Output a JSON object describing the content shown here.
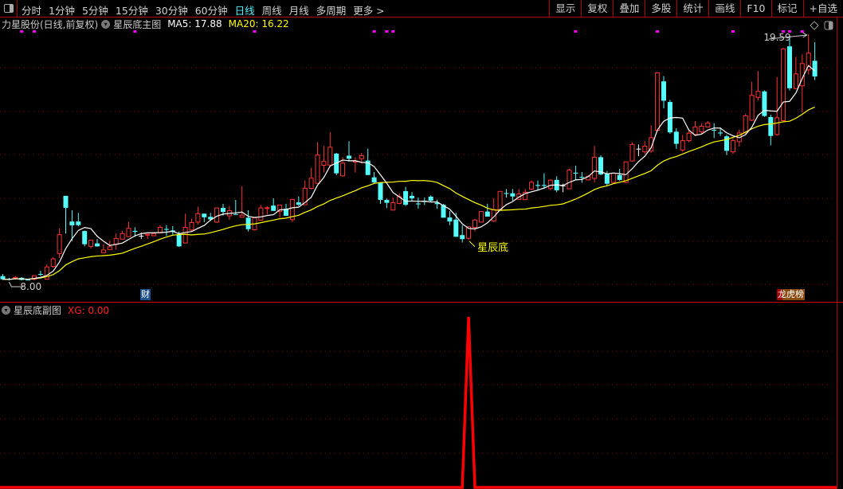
{
  "toolbar": {
    "periods": [
      "分时",
      "1分钟",
      "5分钟",
      "15分钟",
      "30分钟",
      "60分钟",
      "日线",
      "周线",
      "月线",
      "多周期",
      "更多 >"
    ],
    "active_period": "日线",
    "right_buttons": [
      "显示",
      "复权",
      "叠加",
      "多股",
      "统计",
      "画线",
      "F10",
      "标记",
      "+自选"
    ]
  },
  "header": {
    "stock": "力星股份(日线,前复权)",
    "indicator": "星辰底主图",
    "ma5": "MA5: 17.88",
    "ma20": "MA20: 16.22"
  },
  "sub_header": {
    "indicator": "星辰底副图",
    "xg": "XG: 0.00"
  },
  "annotations": {
    "low_label": "8.00",
    "high_label": "19.59",
    "signal_label": "星辰底",
    "badge_cai": "财",
    "badge_lhb": "龙虎榜"
  },
  "colors": {
    "up": "#ff3232",
    "down": "#54fcfc",
    "doji": "#ffffff",
    "ma5": "#ffffff",
    "ma20": "#ffff00",
    "xg": "#ff0000",
    "grid": "#800000",
    "marker": "#ff00ff"
  },
  "chart_data": [
    {
      "type": "candlestick",
      "title": "星辰底主图",
      "series": [
        {
          "name": "MA5",
          "period": 5
        },
        {
          "name": "MA20",
          "period": 20
        }
      ],
      "price_range": [
        8.0,
        19.59
      ],
      "marker_candles": [
        3,
        5,
        21,
        40,
        59,
        61,
        62,
        91,
        104,
        116,
        124,
        125,
        127
      ],
      "signal_candle": 74,
      "badge_cai_candle": 22,
      "badge_lhb_candle": 123,
      "candles_ochl": [
        [
          8.2,
          8.05,
          8.3,
          8.02
        ],
        [
          8.06,
          8.04,
          8.12,
          8.0
        ],
        [
          8.1,
          8.14,
          8.2,
          8.04
        ],
        [
          8.12,
          8.02,
          8.15,
          8.0
        ],
        [
          8.03,
          8.02,
          8.05,
          8.0
        ],
        [
          8.05,
          8.22,
          8.22,
          8.0
        ],
        [
          8.3,
          8.28,
          8.45,
          8.2
        ],
        [
          8.06,
          8.63,
          8.75,
          8.06
        ],
        [
          8.65,
          9.01,
          9.1,
          8.6
        ],
        [
          9.26,
          10.15,
          10.45,
          9.05
        ],
        [
          11.98,
          11.41,
          11.98,
          10.2
        ],
        [
          10.77,
          10.59,
          11.3,
          9.86
        ],
        [
          10.77,
          10.6,
          11.18,
          10.55
        ],
        [
          10.32,
          9.7,
          10.35,
          9.6
        ],
        [
          9.6,
          9.89,
          9.89,
          9.5
        ],
        [
          9.74,
          9.6,
          9.95,
          9.58
        ],
        [
          9.3,
          9.43,
          9.7,
          9.3
        ],
        [
          9.45,
          9.58,
          9.86,
          9.45
        ],
        [
          9.7,
          9.97,
          10.2,
          9.45
        ],
        [
          9.94,
          10.2,
          10.33,
          9.94
        ],
        [
          10.06,
          10.45,
          10.75,
          10.06
        ],
        [
          10.33,
          10.28,
          10.5,
          10.05
        ],
        [
          10.1,
          10.1,
          10.25,
          9.95
        ],
        [
          10.13,
          10.17,
          10.2,
          9.95
        ],
        [
          10.1,
          10.2,
          10.2,
          10.1
        ],
        [
          10.24,
          10.5,
          10.6,
          10.24
        ],
        [
          10.42,
          10.38,
          10.6,
          10.1
        ],
        [
          10.35,
          10.3,
          10.55,
          10.15
        ],
        [
          10.18,
          9.6,
          10.3,
          9.58
        ],
        [
          9.76,
          10.49,
          11.14,
          9.76
        ],
        [
          10.37,
          10.72,
          10.9,
          10.3
        ],
        [
          10.74,
          11.14,
          11.47,
          10.62
        ],
        [
          11.14,
          10.97,
          11.14,
          10.74
        ],
        [
          10.99,
          10.87,
          11.18,
          10.8
        ],
        [
          10.74,
          11.41,
          11.41,
          10.7
        ],
        [
          11.41,
          11.22,
          11.6,
          11.05
        ],
        [
          11.04,
          11.28,
          11.5,
          10.85
        ],
        [
          11.12,
          11.1,
          11.79,
          11.1
        ],
        [
          10.97,
          11.07,
          12.43,
          10.97
        ],
        [
          10.95,
          10.41,
          11.3,
          10.3
        ],
        [
          10.38,
          10.95,
          10.95,
          10.35
        ],
        [
          10.83,
          11.41,
          11.55,
          10.83
        ],
        [
          11.38,
          11.42,
          11.5,
          11.1
        ],
        [
          11.52,
          11.27,
          11.86,
          11.27
        ],
        [
          11.24,
          11.55,
          11.55,
          10.95
        ],
        [
          11.37,
          11.04,
          11.6,
          11.04
        ],
        [
          10.86,
          11.81,
          11.81,
          10.75
        ],
        [
          11.67,
          11.56,
          11.95,
          11.5
        ],
        [
          11.56,
          12.34,
          12.7,
          11.56
        ],
        [
          12.33,
          12.81,
          13.3,
          12.28
        ],
        [
          12.57,
          13.9,
          14.5,
          12.57
        ],
        [
          13.42,
          13.6,
          14.33,
          13.08
        ],
        [
          13.43,
          14.27,
          14.97,
          13.4
        ],
        [
          13.97,
          13.04,
          14.0,
          12.95
        ],
        [
          12.92,
          13.52,
          13.8,
          12.88
        ],
        [
          13.87,
          13.73,
          14.55,
          13.6
        ],
        [
          13.57,
          13.62,
          13.8,
          13.08
        ],
        [
          13.73,
          13.87,
          14.0,
          13.5
        ],
        [
          13.64,
          12.96,
          14.2,
          12.96
        ],
        [
          12.85,
          12.61,
          13.1,
          12.55
        ],
        [
          12.6,
          11.79,
          12.6,
          11.6
        ],
        [
          11.79,
          11.65,
          11.85,
          11.4
        ],
        [
          11.31,
          11.66,
          11.9,
          11.31
        ],
        [
          11.62,
          11.94,
          12.1,
          11.58
        ],
        [
          12.2,
          11.56,
          12.4,
          11.5
        ],
        [
          11.98,
          11.86,
          12.15,
          11.75
        ],
        [
          11.62,
          11.58,
          11.9,
          11.38
        ],
        [
          11.75,
          11.7,
          11.9,
          11.55
        ],
        [
          11.94,
          11.75,
          12.0,
          11.7
        ],
        [
          11.66,
          11.59,
          11.8,
          11.37
        ],
        [
          11.56,
          10.95,
          11.6,
          10.95
        ],
        [
          10.96,
          10.77,
          11.26,
          10.6
        ],
        [
          10.86,
          10.05,
          11.18,
          10.05
        ],
        [
          10.13,
          9.94,
          10.6,
          9.78
        ],
        [
          9.98,
          10.52,
          10.55,
          9.92
        ],
        [
          10.49,
          10.84,
          10.9,
          10.3
        ],
        [
          10.74,
          11.24,
          11.26,
          10.72
        ],
        [
          11.24,
          11.0,
          11.61,
          11.0
        ],
        [
          10.8,
          11.33,
          11.86,
          10.75
        ],
        [
          11.34,
          12.19,
          12.19,
          11.3
        ],
        [
          12.11,
          12.07,
          12.3,
          11.9
        ],
        [
          12.1,
          11.95,
          12.3,
          11.75
        ],
        [
          11.81,
          12.07,
          12.3,
          11.8
        ],
        [
          11.8,
          12.15,
          12.3,
          11.8
        ],
        [
          12.29,
          12.62,
          12.7,
          12.25
        ],
        [
          12.49,
          12.45,
          12.7,
          12.25
        ],
        [
          12.49,
          12.45,
          13.04,
          12.3
        ],
        [
          12.32,
          12.72,
          12.75,
          12.25
        ],
        [
          12.73,
          12.24,
          12.9,
          12.15
        ],
        [
          12.47,
          12.47,
          12.55,
          12.15
        ],
        [
          12.31,
          13.19,
          13.25,
          12.31
        ],
        [
          13.07,
          13.03,
          13.4,
          12.75
        ],
        [
          12.87,
          12.83,
          13.1,
          12.6
        ],
        [
          12.73,
          12.9,
          12.95,
          12.7
        ],
        [
          12.8,
          13.8,
          14.33,
          12.6
        ],
        [
          13.8,
          12.99,
          13.9,
          12.95
        ],
        [
          13.01,
          12.55,
          13.15,
          12.45
        ],
        [
          12.61,
          13.04,
          13.04,
          12.6
        ],
        [
          12.96,
          12.73,
          13.25,
          12.7
        ],
        [
          12.61,
          13.58,
          13.6,
          12.58
        ],
        [
          13.62,
          14.4,
          14.5,
          13.6
        ],
        [
          14.2,
          14.2,
          14.4,
          13.85
        ],
        [
          14.05,
          14.32,
          14.55,
          13.95
        ],
        [
          14.09,
          14.72,
          15.31,
          14.0
        ],
        [
          15.07,
          17.77,
          17.8,
          15.0
        ],
        [
          17.37,
          16.46,
          17.62,
          16.1
        ],
        [
          16.4,
          14.97,
          16.5,
          14.9
        ],
        [
          15.0,
          14.43,
          15.16,
          14.2
        ],
        [
          14.14,
          14.58,
          14.85,
          14.05
        ],
        [
          14.58,
          14.93,
          15.05,
          14.5
        ],
        [
          14.87,
          15.22,
          15.5,
          14.8
        ],
        [
          14.99,
          15.26,
          15.4,
          14.9
        ],
        [
          15.22,
          15.41,
          15.5,
          15.2
        ],
        [
          15.09,
          15.05,
          15.4,
          14.7
        ],
        [
          14.96,
          14.92,
          15.2,
          14.8
        ],
        [
          14.78,
          14.1,
          14.86,
          13.9
        ],
        [
          14.05,
          14.58,
          14.7,
          13.95
        ],
        [
          14.53,
          14.94,
          15.1,
          14.3
        ],
        [
          14.97,
          15.75,
          15.85,
          14.9
        ],
        [
          15.54,
          16.71,
          17.35,
          15.5
        ],
        [
          16.62,
          16.9,
          17.85,
          16.48
        ],
        [
          16.9,
          15.74,
          16.95,
          15.7
        ],
        [
          15.69,
          14.8,
          15.8,
          14.36
        ],
        [
          14.87,
          15.66,
          17.58,
          14.8
        ],
        [
          15.52,
          18.9,
          18.95,
          15.45
        ],
        [
          19.02,
          17.05,
          19.5,
          16.94
        ],
        [
          17.03,
          17.72,
          18.53,
          17.0
        ],
        [
          17.16,
          18.21,
          18.64,
          15.92
        ],
        [
          17.91,
          18.7,
          19.59,
          17.7
        ],
        [
          18.34,
          17.6,
          19.21,
          17.43
        ]
      ]
    },
    {
      "type": "line",
      "title": "星辰底副图",
      "series": [
        {
          "name": "XG",
          "signal_candle": 74,
          "signal_value": 1,
          "other_value": 0
        }
      ],
      "ylim": [
        0,
        1
      ]
    }
  ]
}
